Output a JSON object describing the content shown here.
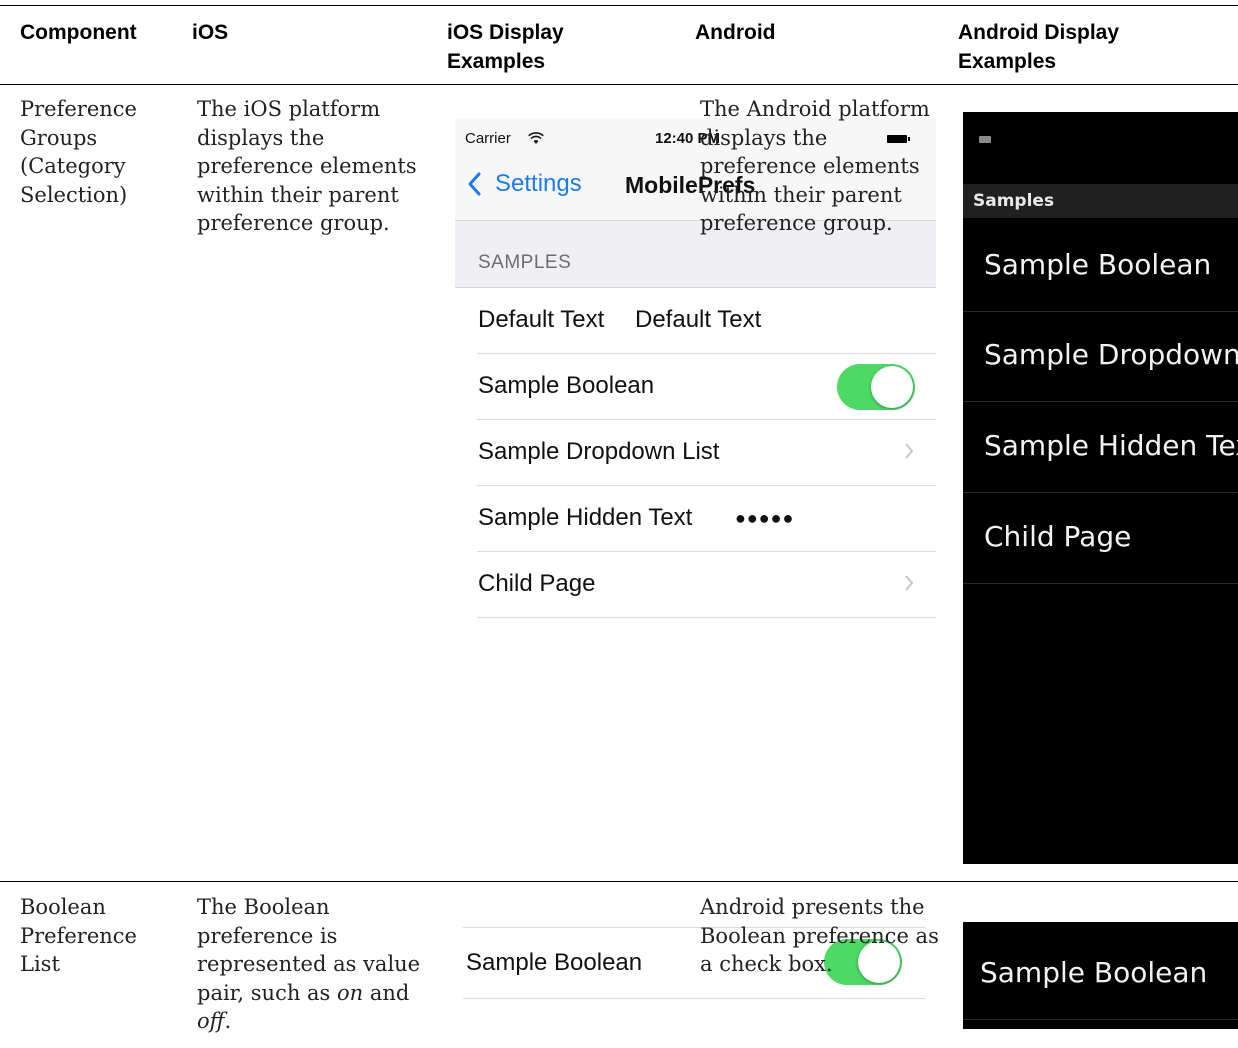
{
  "headers": {
    "component": "Component",
    "ios": "iOS",
    "ios_display": "iOS Display Examples",
    "android": "Android",
    "android_display": "Android Display Examples"
  },
  "rows": [
    {
      "component": "Preference Groups (Category Selection)",
      "ios": "The iOS platform displays the preference elements within their parent preference group.",
      "android": "The Android platform displays the preference elements within their parent preference group."
    },
    {
      "component": "Boolean Preference List",
      "ios_pre": "The Boolean preference is represented as value pair, such as ",
      "ios_on": "on",
      "ios_mid": " and ",
      "ios_off": "off",
      "ios_post": ".",
      "android": "Android presents the Boolean preference as a check box."
    }
  ],
  "ios_example": {
    "carrier": "Carrier",
    "wifi_icon": "wifi-icon",
    "time": "12:40 PM",
    "back_label": "Settings",
    "title": "MobilePrefs",
    "section": "SAMPLES",
    "items": [
      {
        "label": "Default Text",
        "value": "Default Text"
      },
      {
        "label": "Sample Boolean",
        "toggle": "on"
      },
      {
        "label": "Sample Dropdown List",
        "chevron": true
      },
      {
        "label": "Sample Hidden Text",
        "value": "●●●●●"
      },
      {
        "label": "Child Page",
        "chevron": true
      }
    ],
    "toggle_color": "#4cd964",
    "accent": "#1a7cf4"
  },
  "android_example": {
    "header": "Samples",
    "items": [
      "Sample Boolean",
      "Sample Dropdown",
      "Sample Hidden Tex",
      "Child Page"
    ]
  },
  "boolean_example": {
    "ios_label": "Sample Boolean",
    "android_label": "Sample Boolean"
  }
}
